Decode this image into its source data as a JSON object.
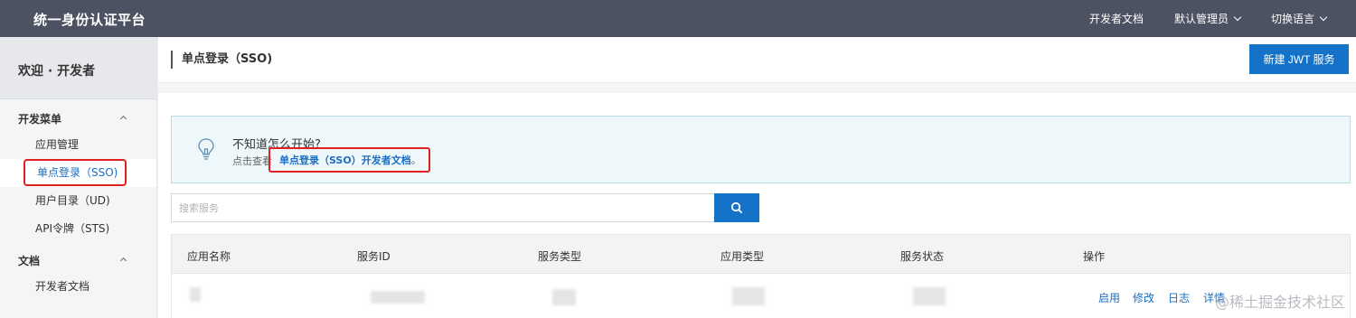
{
  "header": {
    "brand": "统一身份认证平台",
    "nav": {
      "docs": "开发者文档",
      "account": "默认管理员",
      "language": "切换语言"
    }
  },
  "sidebar": {
    "welcome": "欢迎 · 开发者",
    "sections": [
      {
        "title": "开发菜单",
        "items": [
          {
            "label": "应用管理"
          },
          {
            "label": "单点登录（SSO)",
            "active": true
          },
          {
            "label": "用户目录（UD)"
          },
          {
            "label": "API令牌（STS)"
          }
        ]
      },
      {
        "title": "文档",
        "items": [
          {
            "label": "开发者文档"
          }
        ]
      }
    ]
  },
  "main": {
    "title": "单点登录（SSO)",
    "new_button": "新建 JWT 服务",
    "tip": {
      "heading": "不知道怎么开始?",
      "prefix": "点击查看",
      "link": "单点登录（SSO）开发者文档",
      "suffix": "。"
    },
    "search": {
      "placeholder": "搜索服务",
      "value": ""
    },
    "table": {
      "columns": [
        "应用名称",
        "服务ID",
        "服务类型",
        "应用类型",
        "服务状态",
        "操作"
      ],
      "row_actions": [
        "启用",
        "修改",
        "日志",
        "详情"
      ]
    }
  },
  "watermark": "@稀土掘金技术社区",
  "colors": {
    "topbar": "#4d5263",
    "primary": "#1473c9",
    "link": "#1b6ec2",
    "highlight_border": "#e02020"
  }
}
